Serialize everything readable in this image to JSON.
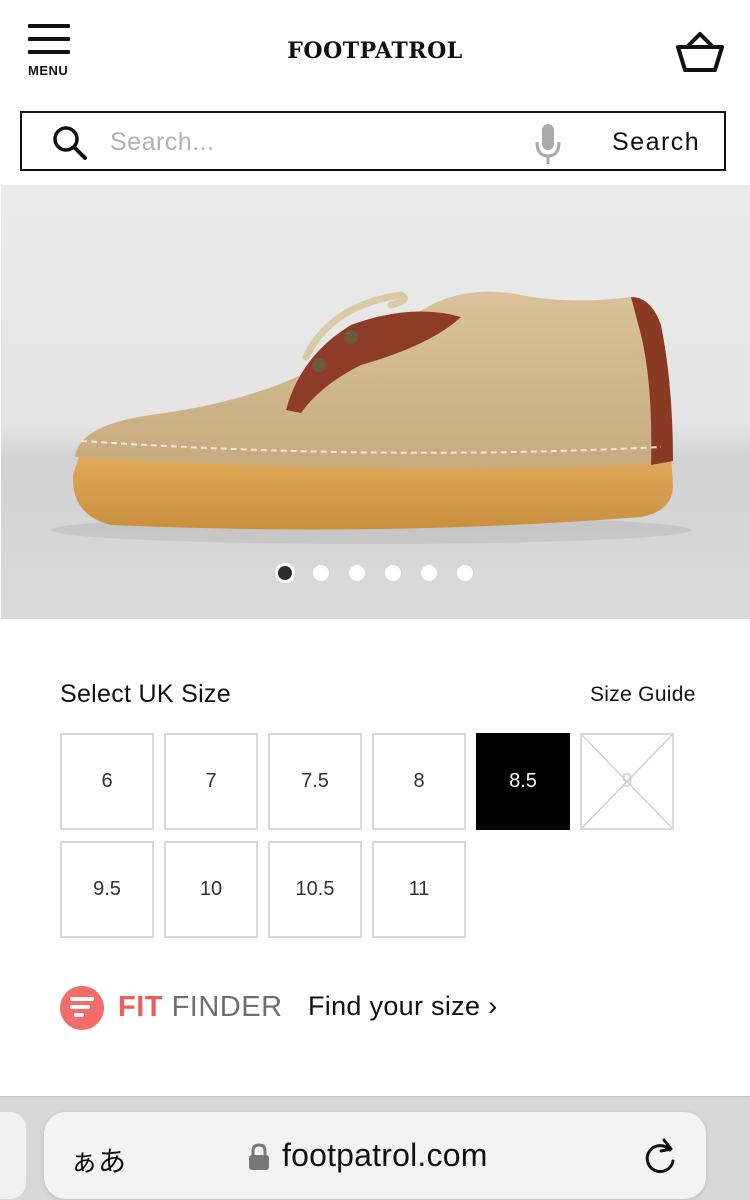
{
  "header": {
    "menu_label": "MENU",
    "logo_text": "FOOTPATROL"
  },
  "search": {
    "placeholder": "Search...",
    "button_label": "Search"
  },
  "gallery": {
    "image_count": 6,
    "active_index": 0
  },
  "sizes": {
    "title": "Select UK Size",
    "guide_label": "Size Guide",
    "options": [
      {
        "label": "6",
        "state": "available"
      },
      {
        "label": "7",
        "state": "available"
      },
      {
        "label": "7.5",
        "state": "available"
      },
      {
        "label": "8",
        "state": "available"
      },
      {
        "label": "8.5",
        "state": "selected"
      },
      {
        "label": "9",
        "state": "unavailable"
      },
      {
        "label": "9.5",
        "state": "available"
      },
      {
        "label": "10",
        "state": "available"
      },
      {
        "label": "10.5",
        "state": "available"
      },
      {
        "label": "11",
        "state": "available"
      }
    ]
  },
  "fit_finder": {
    "brand_fit": "FIT",
    "brand_finder": "FINDER",
    "link_text": "Find your size ›",
    "accent": "#f36b6b"
  },
  "browser": {
    "text_size_label": "ぁあ",
    "url": "footpatrol.com"
  }
}
